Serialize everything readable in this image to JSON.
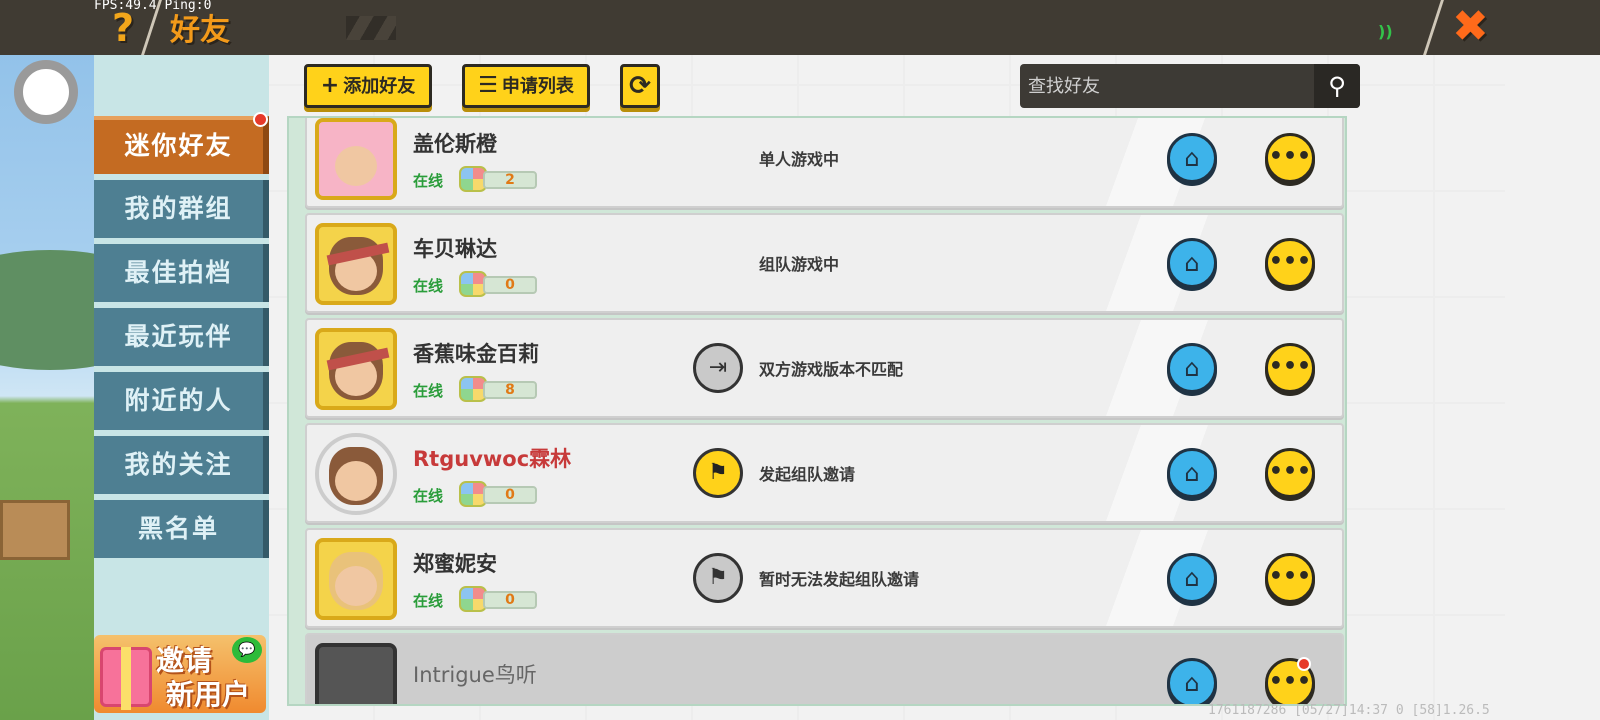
{
  "debug": {
    "fps": "FPS:49.4  Ping:0"
  },
  "header": {
    "help_glyph": "?",
    "title": "好友",
    "close_glyph": "✖",
    "signal_glyph": "))"
  },
  "sidebar": {
    "items": [
      {
        "label": "迷你好友",
        "active": true
      },
      {
        "label": "我的群组"
      },
      {
        "label": "最佳拍档"
      },
      {
        "label": "最近玩伴"
      },
      {
        "label": "附近的人"
      },
      {
        "label": "我的关注"
      },
      {
        "label": "黑名单"
      }
    ],
    "invite": {
      "line1": "邀请",
      "line2": "新用户",
      "wechat_glyph": "💬"
    }
  },
  "toolbar": {
    "add_friend": {
      "icon": "+",
      "label": "添加好友"
    },
    "request_list": {
      "icon": "☰",
      "label": "申请列表"
    },
    "refresh_glyph": "⟳"
  },
  "search": {
    "placeholder": "查找好友",
    "icon_glyph": "⚲"
  },
  "friends": [
    {
      "name": "盖伦斯橙",
      "online": "在线",
      "level": "2",
      "status": "单人游戏中",
      "action": null
    },
    {
      "name": "车贝琳达",
      "online": "在线",
      "level": "0",
      "status": "组队游戏中",
      "action": null
    },
    {
      "name": "香蕉味金百莉",
      "online": "在线",
      "level": "8",
      "status": "双方游戏版本不匹配",
      "action": "enter-grey"
    },
    {
      "name": "Rtguvwoc霖林",
      "online": "在线",
      "level": "0",
      "status": "发起组队邀请",
      "action": "flag-yellow"
    },
    {
      "name": "郑蜜妮安",
      "online": "在线",
      "level": "0",
      "status": "暂时无法发起组队邀请",
      "action": "flag-grey"
    },
    {
      "name": "Intrigue鸟听",
      "online": "",
      "level": "",
      "status": "",
      "action": null
    }
  ],
  "glyphs": {
    "home": "⌂",
    "chat": "•••",
    "enter": "⇥",
    "flag": "⚑"
  },
  "footer": "1761187286   [05/27]14:37 0  [58]1.26.5",
  "colors": {
    "accent_yellow": "#ffd21a",
    "active_tab": "#c46b22",
    "tab": "#4e7f92",
    "online_green": "#2a9d3a",
    "home_blue": "#3db3ea"
  }
}
